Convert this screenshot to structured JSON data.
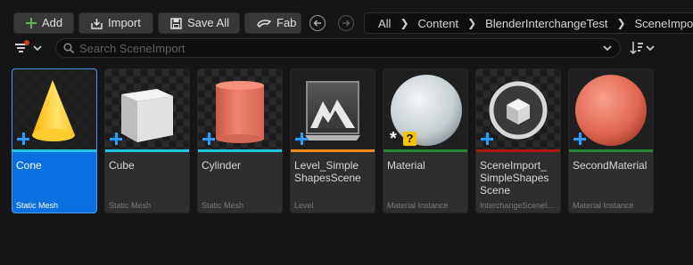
{
  "toolbar": {
    "add_label": "Add",
    "import_label": "Import",
    "save_all_label": "Save All",
    "fab_label": "Fab"
  },
  "breadcrumb": [
    "All",
    "Content",
    "BlenderInterchangeTest",
    "SceneImport"
  ],
  "search": {
    "placeholder": "Search SceneImport"
  },
  "colors": {
    "selected": "#0a70e0",
    "mesh_strip": "#22c4e0",
    "level_strip": "#f08a1c",
    "material_strip": "#1e8a3a",
    "pipeline_strip": "#b01818",
    "add_icon": "#58b84a",
    "badge_plus": "#2b9cff"
  },
  "assets": [
    {
      "name": "Cone",
      "type": "Static Mesh",
      "icon": "cone-thumbnail",
      "selected": true
    },
    {
      "name": "Cube",
      "type": "Static Mesh",
      "icon": "cube-thumbnail"
    },
    {
      "name": "Cylinder",
      "type": "Static Mesh",
      "icon": "cylinder-thumbnail"
    },
    {
      "name": "Level_Simple ShapesScene",
      "type": "Level",
      "icon": "level-thumbnail"
    },
    {
      "name": "Material",
      "type": "Material Instance",
      "icon": "material-sphere-thumbnail"
    },
    {
      "name": "SceneImport_ SimpleShapes Scene",
      "type": "InterchangeSceneI...",
      "icon": "scene-import-thumbnail"
    },
    {
      "name": "SecondMaterial",
      "type": "Material Instance",
      "icon": "second-material-sphere-thumbnail"
    }
  ]
}
